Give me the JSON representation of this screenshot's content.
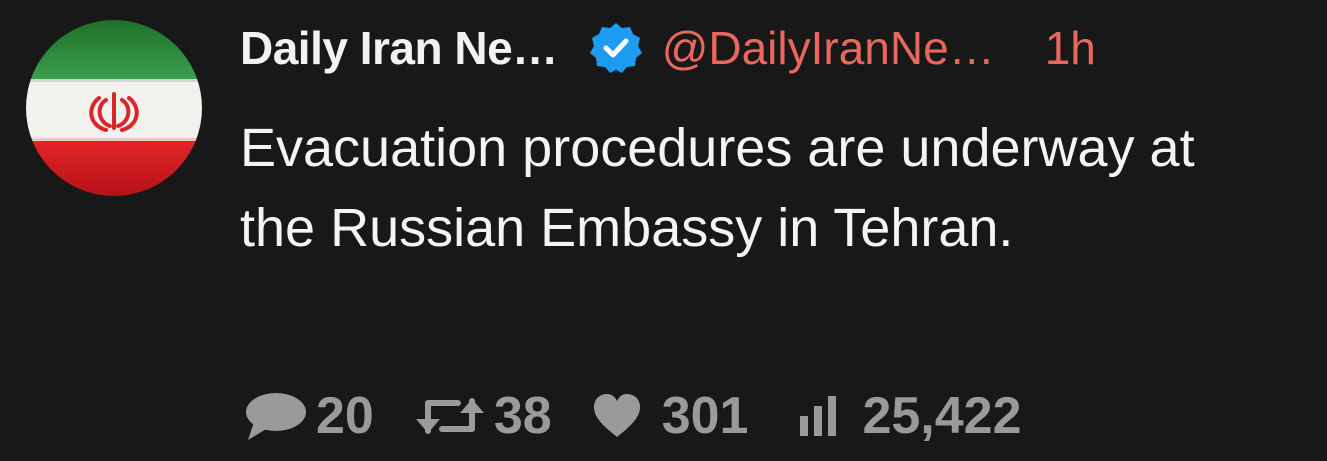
{
  "tweet": {
    "author_name": "Daily Iran Ne…",
    "author_handle": "@DailyIranNe…",
    "time_ago": "1h",
    "text": "Evacuation procedures are underway at the Russian Embassy in Tehran."
  },
  "stats": {
    "replies": "20",
    "retweets": "38",
    "likes": "301",
    "views": "25,422"
  },
  "icons": {
    "verified": "verified-badge-icon",
    "reply": "speech-bubble-icon",
    "retweet": "retweet-arrows-icon",
    "like": "heart-icon",
    "views": "bar-chart-icon"
  },
  "colors": {
    "background": "#181818",
    "accent": "#e8685d",
    "verified": "#1d9bf0",
    "muted": "#9a9a9a",
    "flag_green": "#239f40",
    "flag_white": "#ffffff",
    "flag_red": "#da0000"
  }
}
